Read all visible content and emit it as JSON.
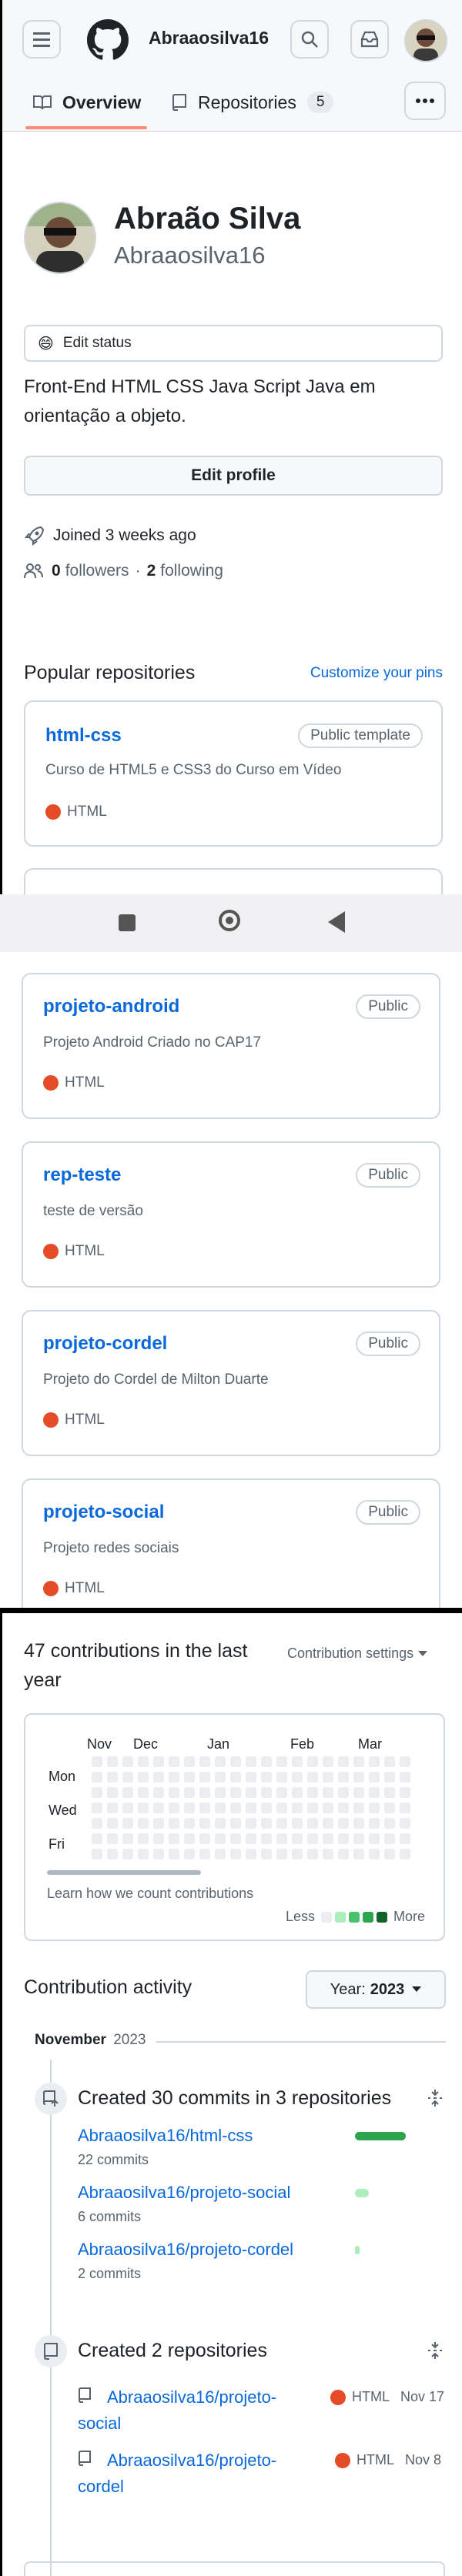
{
  "header": {
    "username": "Abraaosilva16",
    "tabs": [
      {
        "label": "Overview"
      },
      {
        "label": "Repositories",
        "count": "5"
      }
    ]
  },
  "profile": {
    "name": "Abraão Silva",
    "login": "Abraaosilva16",
    "status_emoji": "😄",
    "status": "Edit status",
    "bio": "Front-End HTML CSS Java Script Java em orientação a objeto.",
    "edit_button": "Edit profile",
    "joined": "Joined 3 weeks ago",
    "followers_count": "0",
    "followers_label": "followers",
    "separator": "·",
    "following_count": "2",
    "following_label": "following"
  },
  "popular": {
    "title": "Popular repositories",
    "customize": "Customize your pins",
    "repos": [
      {
        "name": "html-css",
        "visibility": "Public template",
        "desc": "Curso de HTML5 e CSS3 do Curso em Vídeo",
        "lang": "HTML"
      },
      {
        "name": "projeto-android",
        "visibility": "Public",
        "desc": "Projeto Android Criado no CAP17",
        "lang": "HTML"
      },
      {
        "name": "rep-teste",
        "visibility": "Public",
        "desc": "teste de versão",
        "lang": "HTML"
      },
      {
        "name": "projeto-cordel",
        "visibility": "Public",
        "desc": "Projeto do Cordel de Milton Duarte",
        "lang": "HTML"
      },
      {
        "name": "projeto-social",
        "visibility": "Public",
        "desc": "Projeto redes sociais",
        "lang": "HTML"
      }
    ]
  },
  "contributions": {
    "title": "47 contributions in the last year",
    "settings": "Contribution settings",
    "months": [
      "Nov",
      "Dec",
      "Jan",
      "Feb",
      "Mar"
    ],
    "days": [
      "Mon",
      "Wed",
      "Fri"
    ],
    "learn": "Learn how we count contributions",
    "less": "Less",
    "more": "More"
  },
  "activity": {
    "title": "Contribution activity",
    "year_label": "Year:",
    "year": "2023",
    "month": "November",
    "month_year": "2023",
    "commits_title": "Created 30 commits in 3 repositories",
    "commits": [
      {
        "repo": "Abraaosilva16/html-css",
        "count": "22 commits",
        "fraction": 0.73
      },
      {
        "repo": "Abraaosilva16/projeto-social",
        "count": "6 commits",
        "fraction": 0.2
      },
      {
        "repo": "Abraaosilva16/projeto-cordel",
        "count": "2 commits",
        "fraction": 0.07
      }
    ],
    "repos_title": "Created 2 repositories",
    "created": [
      {
        "repo": "Abraaosilva16/projeto-social",
        "lang": "HTML",
        "date": "Nov 17"
      },
      {
        "repo": "Abraaosilva16/projeto-cordel",
        "lang": "HTML",
        "date": "Nov 8"
      }
    ]
  },
  "colors": {
    "accent": "#0969da",
    "html": "#e34c26",
    "green": "#2da44e"
  }
}
